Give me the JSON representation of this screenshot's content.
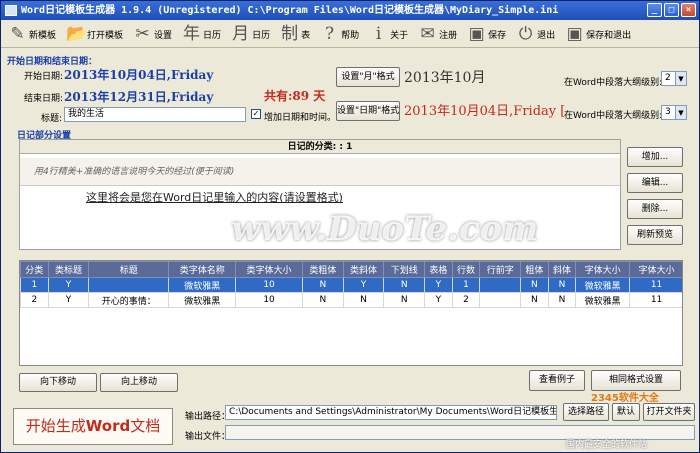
{
  "window": {
    "title": "Word日记模板生成器 1.9.4  (Unregistered)  C:\\Program Files\\Word日记模板生成器\\MyDiary_Simple.ini",
    "min": "_",
    "max": "□",
    "close": "×"
  },
  "toolbar": [
    {
      "label": "新模板",
      "icon": "new-template-icon",
      "glyph": "✎"
    },
    {
      "label": "打开模板",
      "icon": "open-folder-icon",
      "glyph": "📂"
    },
    {
      "label": "设置",
      "icon": "settings-icon",
      "glyph": "✂"
    },
    {
      "label": "日历",
      "icon": "year-calendar-icon",
      "glyph": "年"
    },
    {
      "label": "日历",
      "icon": "month-calendar-icon",
      "glyph": "月"
    },
    {
      "label": "表",
      "icon": "table-icon",
      "glyph": "制"
    },
    {
      "label": "帮助",
      "icon": "help-icon",
      "glyph": "?"
    },
    {
      "label": "关于",
      "icon": "info-icon",
      "glyph": "i"
    },
    {
      "label": "注册",
      "icon": "register-icon",
      "glyph": "✉"
    },
    {
      "label": "保存",
      "icon": "save-icon",
      "glyph": "▣"
    },
    {
      "label": "退出",
      "icon": "exit-icon",
      "glyph": "⏻"
    },
    {
      "label": "保存和退出",
      "icon": "save-exit-icon",
      "glyph": "▣"
    }
  ],
  "dates": {
    "section_title": "开始日期和结束日期：",
    "start_label": "开始日期:",
    "start_value": "2013年10月04日,Friday",
    "end_label": "结束日期:",
    "end_value": "2013年12月31日,Friday",
    "total": "共有:89 天",
    "title_label": "标题:",
    "title_value": "我的生活",
    "add_date_label": "增加日期和时间。",
    "add_date_checked": true
  },
  "format": {
    "month_button": "设置\"月\"格式",
    "month_preview": "2013年10月",
    "day_button": "设置\"日期\"格式",
    "day_preview": "2013年10月04日,Friday [",
    "outline_label_1": "在Word中段落大纲级别:",
    "outline_value_1": "2",
    "outline_label_2": "在Word中段落大纲级别:",
    "outline_value_2": "3"
  },
  "diary": {
    "section_title": "日记部分设置",
    "category_header": "日记的分类: : 1",
    "hint_text": "用4行精美+准确的语言说明今天的经过(便于阅读)",
    "content_text": "这里将会是您在Word日记里输入的内容(请设置格式)",
    "buttons": [
      "增加...",
      "编辑...",
      "删除...",
      "刷新预览"
    ]
  },
  "grid": {
    "columns": [
      "分类",
      "类标题",
      "标题",
      "类字体名称",
      "类字体大小",
      "类粗体",
      "类斜体",
      "下划线",
      "表格",
      "行数",
      "行前字",
      "粗体",
      "斜体",
      "字体大小",
      "字体大小"
    ],
    "rows": [
      [
        "1",
        "Y",
        "",
        "微软雅黑",
        "10",
        "N",
        "Y",
        "N",
        "Y",
        "1",
        "",
        "N",
        "N",
        "微软雅黑",
        "11"
      ],
      [
        "2",
        "Y",
        "开心的事情：",
        "微软雅黑",
        "10",
        "N",
        "N",
        "N",
        "Y",
        "2",
        "",
        "N",
        "N",
        "微软雅黑",
        "11"
      ]
    ]
  },
  "actions": {
    "move_down": "向下移动",
    "move_up": "向上移动",
    "view_example": "查看例子",
    "same_format": "相同格式设置"
  },
  "output": {
    "start_label_1": "开始生成",
    "start_label_2": "Word",
    "start_label_3": "文档",
    "path_label": "输出路径：",
    "path_value": "C:\\Documents and Settings\\Administrator\\My Documents\\Word日记模板生成器",
    "file_label": "输出文件：",
    "file_value": "",
    "choose": "选择路径",
    "default": "默认",
    "open_folder": "打开文件夹"
  },
  "watermark": "www.DuoTe.com",
  "corner_brand": "2345软件大全",
  "corner_sub": "国内最安全的软件站",
  "colors": {
    "title_blue": "#1e4fb8",
    "date_blue": "#1a3fa8",
    "accent_red": "#c42a1c",
    "grid_header": "#5a6b9a",
    "selection": "#316ac5"
  }
}
